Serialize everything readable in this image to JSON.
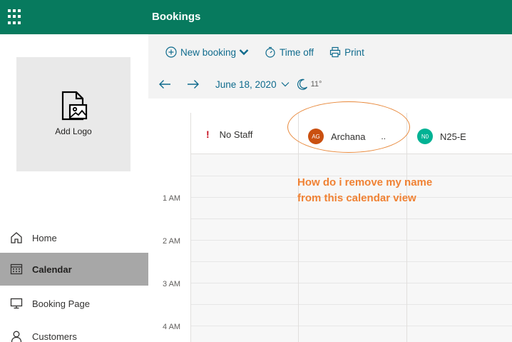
{
  "header": {
    "app_title": "Bookings"
  },
  "sidebar": {
    "logo_label": "Add Logo",
    "items": [
      {
        "label": "Home",
        "icon": "home-icon",
        "active": false
      },
      {
        "label": "Calendar",
        "icon": "calendar-icon",
        "active": true
      },
      {
        "label": "Booking Page",
        "icon": "monitor-icon",
        "active": false
      },
      {
        "label": "Customers",
        "icon": "person-icon",
        "active": false
      }
    ]
  },
  "toolbar": {
    "new_booking": "New booking",
    "time_off": "Time off",
    "print": "Print"
  },
  "datebar": {
    "date": "June 18, 2020",
    "temperature": "11°"
  },
  "calendar": {
    "hours": [
      "1 AM",
      "2 AM",
      "3 AM",
      "4 AM"
    ],
    "staff": [
      {
        "label": "No Staff",
        "initials": ""
      },
      {
        "label": "Archana",
        "initials": "AG",
        "suffix": ".."
      },
      {
        "label": "N25-E",
        "initials": "N0"
      }
    ]
  },
  "annotation": {
    "text": "How do i remove my name from this calendar view"
  },
  "colors": {
    "brand": "#077a5e",
    "link": "#0f6b8d",
    "annotation": "#f08234",
    "avatar_ag": "#ca5010",
    "avatar_n0": "#00b294"
  }
}
